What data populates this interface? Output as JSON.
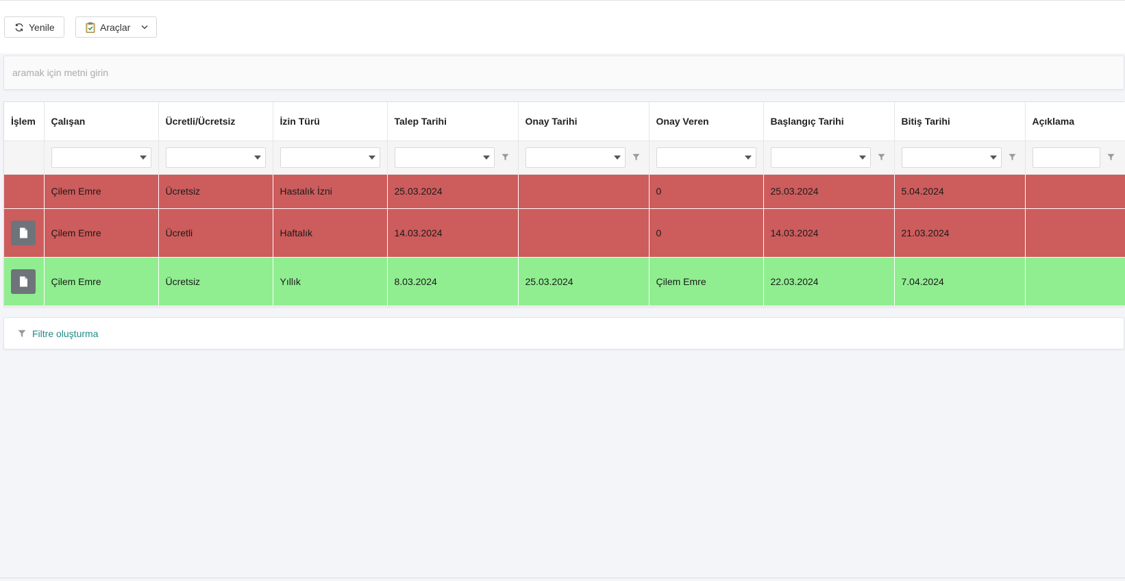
{
  "colors": {
    "rejected_row": "#cd5c5c",
    "approved_row": "#90ee90",
    "link": "#1f8a87"
  },
  "toolbar": {
    "refresh_label": "Yenile",
    "tools_label": "Araçlar",
    "refresh_icon": "refresh-icon",
    "tools_icon": "clipboard-check-icon"
  },
  "search": {
    "placeholder": "aramak için metni girin"
  },
  "table": {
    "columns": [
      "İşlem",
      "Çalışan",
      "Ücretli/Ücretsiz",
      "İzin Türü",
      "Talep Tarihi",
      "Onay Tarihi",
      "Onay Veren",
      "Başlangıç Tarihi",
      "Bitiş Tarihi",
      "Açıklama"
    ],
    "rows": [
      {
        "status": "rejected",
        "has_action": false,
        "cells": [
          "",
          "Çilem Emre",
          "Ücretsiz",
          "Hastalık İzni",
          "25.03.2024",
          "",
          "0",
          "25.03.2024",
          "5.04.2024",
          ""
        ]
      },
      {
        "status": "rejected",
        "has_action": true,
        "cells": [
          "",
          "Çilem Emre",
          "Ücretli",
          "Haftalık",
          "14.03.2024",
          "",
          "0",
          "14.03.2024",
          "21.03.2024",
          ""
        ]
      },
      {
        "status": "approved",
        "has_action": true,
        "cells": [
          "",
          "Çilem Emre",
          "Ücretsiz",
          "Yıllık",
          "8.03.2024",
          "25.03.2024",
          "Çilem Emre",
          "22.03.2024",
          "7.04.2024",
          ""
        ]
      }
    ]
  },
  "filter_builder": {
    "label": "Filtre oluşturma",
    "icon": "filter-icon"
  }
}
